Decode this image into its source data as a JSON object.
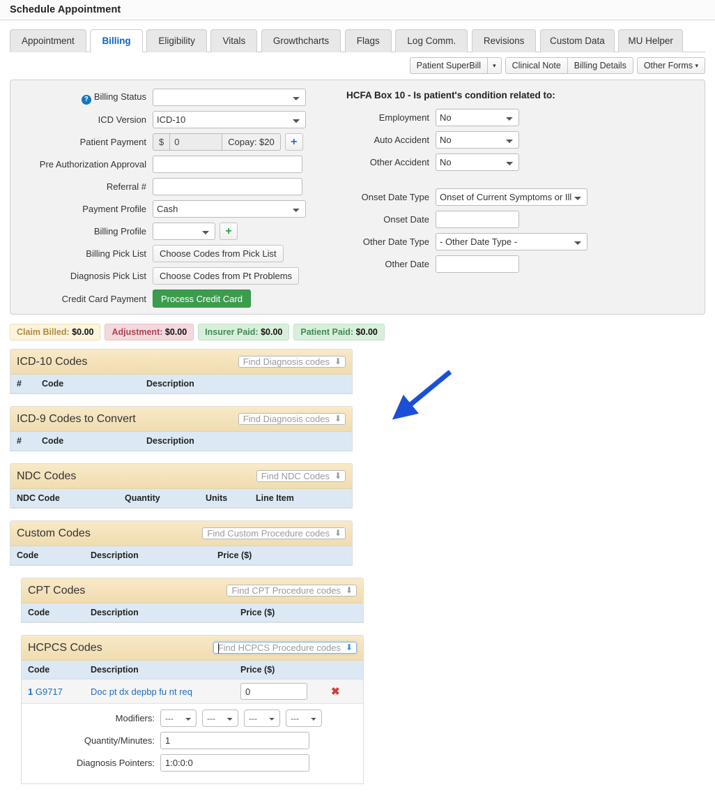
{
  "page": {
    "title": "Schedule Appointment"
  },
  "tabs": [
    {
      "label": "Appointment",
      "active": false
    },
    {
      "label": "Billing",
      "active": true
    },
    {
      "label": "Eligibility",
      "active": false
    },
    {
      "label": "Vitals",
      "active": false
    },
    {
      "label": "Growthcharts",
      "active": false
    },
    {
      "label": "Flags",
      "active": false
    },
    {
      "label": "Log Comm.",
      "active": false
    },
    {
      "label": "Revisions",
      "active": false
    },
    {
      "label": "Custom Data",
      "active": false
    },
    {
      "label": "MU Helper",
      "active": false
    }
  ],
  "toolbar": {
    "patient_superbill": "Patient SuperBill",
    "superbill_caret": "▾",
    "clinical_note": "Clinical Note",
    "billing_details": "Billing Details",
    "other_forms": "Other Forms",
    "other_forms_caret": "▾"
  },
  "form_left": {
    "help_icon_glyph": "?",
    "billing_status_label": "Billing Status",
    "billing_status_value": "",
    "icd_version_label": "ICD Version",
    "icd_version_value": "ICD-10",
    "patient_payment_label": "Patient Payment",
    "currency_symbol": "$",
    "patient_payment_value": "0",
    "copay_text": "Copay: $20",
    "add_payment_glyph": "+",
    "pre_auth_label": "Pre Authorization Approval",
    "pre_auth_value": "",
    "referral_label": "Referral #",
    "referral_value": "",
    "payment_profile_label": "Payment Profile",
    "payment_profile_value": "Cash",
    "billing_profile_label": "Billing Profile",
    "billing_profile_value": "",
    "add_billing_profile_glyph": "+",
    "billing_pick_list_label": "Billing Pick List",
    "billing_pick_list_button": "Choose Codes from Pick List",
    "diagnosis_pick_list_label": "Diagnosis Pick List",
    "diagnosis_pick_list_button": "Choose Codes from Pt Problems",
    "credit_card_label": "Credit Card Payment",
    "credit_card_button": "Process Credit Card"
  },
  "form_right": {
    "hcfa_title": "HCFA Box 10 - Is patient's condition related to:",
    "employment_label": "Employment",
    "employment_value": "No",
    "auto_accident_label": "Auto Accident",
    "auto_accident_value": "No",
    "other_accident_label": "Other Accident",
    "other_accident_value": "No",
    "onset_date_type_label": "Onset Date Type",
    "onset_date_type_value": "Onset of Current Symptoms or Illness",
    "onset_date_label": "Onset Date",
    "onset_date_value": "",
    "other_date_type_label": "Other Date Type",
    "other_date_type_value": "- Other Date Type -",
    "other_date_label": "Other Date",
    "other_date_value": ""
  },
  "badges": [
    {
      "label": "Claim Billed:",
      "amount": "$0.00",
      "style": "billed"
    },
    {
      "label": "Adjustment:",
      "amount": "$0.00",
      "style": "adjust"
    },
    {
      "label": "Insurer Paid:",
      "amount": "$0.00",
      "style": "insurer"
    },
    {
      "label": "Patient Paid:",
      "amount": "$0.00",
      "style": "patient"
    }
  ],
  "panels": {
    "icd10": {
      "title": "ICD-10 Codes",
      "search_placeholder": "Find Diagnosis codes",
      "columns": [
        "#",
        "Code",
        "Description"
      ]
    },
    "icd9": {
      "title": "ICD-9 Codes to Convert",
      "search_placeholder": "Find Diagnosis codes",
      "columns": [
        "#",
        "Code",
        "Description"
      ]
    },
    "ndc": {
      "title": "NDC Codes",
      "search_placeholder": "Find NDC Codes",
      "columns": [
        "NDC Code",
        "Quantity",
        "Units",
        "Line Item"
      ]
    },
    "custom": {
      "title": "Custom Codes",
      "search_placeholder": "Find Custom Procedure codes",
      "columns": [
        "Code",
        "Description",
        "Price ($)"
      ]
    },
    "cpt": {
      "title": "CPT Codes",
      "search_placeholder": "Find CPT Procedure codes",
      "columns": [
        "Code",
        "Description",
        "Price ($)"
      ]
    },
    "hcpcs": {
      "title": "HCPCS Codes",
      "search_placeholder": "Find HCPCS Procedure codes",
      "search_focused": true,
      "columns": [
        "Code",
        "Description",
        "Price ($)"
      ],
      "row": {
        "index": "1",
        "code": "G9717",
        "description": "Doc pt dx depbp fu nt req",
        "price": "0",
        "delete_glyph": "✖"
      },
      "detail": {
        "modifiers_label": "Modifiers:",
        "modifier_values": [
          "---",
          "---",
          "---",
          "---"
        ],
        "quantity_label": "Quantity/Minutes:",
        "quantity_value": "1",
        "pointers_label": "Diagnosis Pointers:",
        "pointers_value": "1:0:0:0"
      }
    }
  },
  "annotation": {
    "arrow_color": "#1b4fd8"
  }
}
